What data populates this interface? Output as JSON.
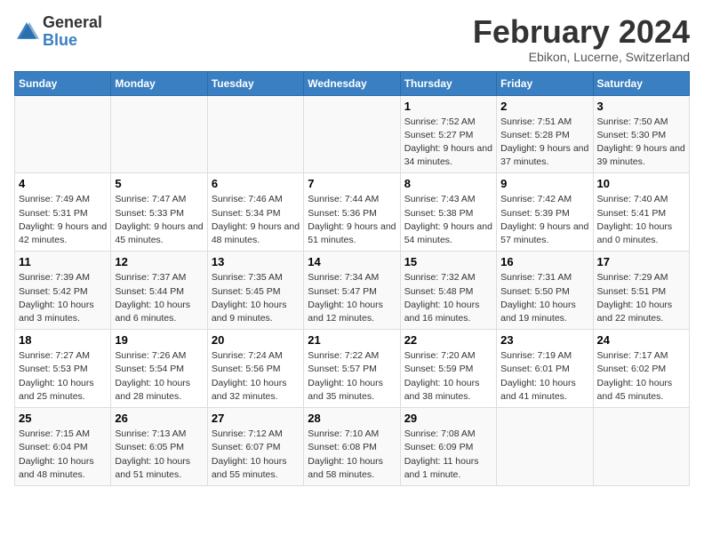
{
  "header": {
    "logo_general": "General",
    "logo_blue": "Blue",
    "title": "February 2024",
    "subtitle": "Ebikon, Lucerne, Switzerland"
  },
  "columns": [
    "Sunday",
    "Monday",
    "Tuesday",
    "Wednesday",
    "Thursday",
    "Friday",
    "Saturday"
  ],
  "weeks": [
    [
      {
        "day": "",
        "info": ""
      },
      {
        "day": "",
        "info": ""
      },
      {
        "day": "",
        "info": ""
      },
      {
        "day": "",
        "info": ""
      },
      {
        "day": "1",
        "info": "Sunrise: 7:52 AM\nSunset: 5:27 PM\nDaylight: 9 hours and 34 minutes."
      },
      {
        "day": "2",
        "info": "Sunrise: 7:51 AM\nSunset: 5:28 PM\nDaylight: 9 hours and 37 minutes."
      },
      {
        "day": "3",
        "info": "Sunrise: 7:50 AM\nSunset: 5:30 PM\nDaylight: 9 hours and 39 minutes."
      }
    ],
    [
      {
        "day": "4",
        "info": "Sunrise: 7:49 AM\nSunset: 5:31 PM\nDaylight: 9 hours and 42 minutes."
      },
      {
        "day": "5",
        "info": "Sunrise: 7:47 AM\nSunset: 5:33 PM\nDaylight: 9 hours and 45 minutes."
      },
      {
        "day": "6",
        "info": "Sunrise: 7:46 AM\nSunset: 5:34 PM\nDaylight: 9 hours and 48 minutes."
      },
      {
        "day": "7",
        "info": "Sunrise: 7:44 AM\nSunset: 5:36 PM\nDaylight: 9 hours and 51 minutes."
      },
      {
        "day": "8",
        "info": "Sunrise: 7:43 AM\nSunset: 5:38 PM\nDaylight: 9 hours and 54 minutes."
      },
      {
        "day": "9",
        "info": "Sunrise: 7:42 AM\nSunset: 5:39 PM\nDaylight: 9 hours and 57 minutes."
      },
      {
        "day": "10",
        "info": "Sunrise: 7:40 AM\nSunset: 5:41 PM\nDaylight: 10 hours and 0 minutes."
      }
    ],
    [
      {
        "day": "11",
        "info": "Sunrise: 7:39 AM\nSunset: 5:42 PM\nDaylight: 10 hours and 3 minutes."
      },
      {
        "day": "12",
        "info": "Sunrise: 7:37 AM\nSunset: 5:44 PM\nDaylight: 10 hours and 6 minutes."
      },
      {
        "day": "13",
        "info": "Sunrise: 7:35 AM\nSunset: 5:45 PM\nDaylight: 10 hours and 9 minutes."
      },
      {
        "day": "14",
        "info": "Sunrise: 7:34 AM\nSunset: 5:47 PM\nDaylight: 10 hours and 12 minutes."
      },
      {
        "day": "15",
        "info": "Sunrise: 7:32 AM\nSunset: 5:48 PM\nDaylight: 10 hours and 16 minutes."
      },
      {
        "day": "16",
        "info": "Sunrise: 7:31 AM\nSunset: 5:50 PM\nDaylight: 10 hours and 19 minutes."
      },
      {
        "day": "17",
        "info": "Sunrise: 7:29 AM\nSunset: 5:51 PM\nDaylight: 10 hours and 22 minutes."
      }
    ],
    [
      {
        "day": "18",
        "info": "Sunrise: 7:27 AM\nSunset: 5:53 PM\nDaylight: 10 hours and 25 minutes."
      },
      {
        "day": "19",
        "info": "Sunrise: 7:26 AM\nSunset: 5:54 PM\nDaylight: 10 hours and 28 minutes."
      },
      {
        "day": "20",
        "info": "Sunrise: 7:24 AM\nSunset: 5:56 PM\nDaylight: 10 hours and 32 minutes."
      },
      {
        "day": "21",
        "info": "Sunrise: 7:22 AM\nSunset: 5:57 PM\nDaylight: 10 hours and 35 minutes."
      },
      {
        "day": "22",
        "info": "Sunrise: 7:20 AM\nSunset: 5:59 PM\nDaylight: 10 hours and 38 minutes."
      },
      {
        "day": "23",
        "info": "Sunrise: 7:19 AM\nSunset: 6:01 PM\nDaylight: 10 hours and 41 minutes."
      },
      {
        "day": "24",
        "info": "Sunrise: 7:17 AM\nSunset: 6:02 PM\nDaylight: 10 hours and 45 minutes."
      }
    ],
    [
      {
        "day": "25",
        "info": "Sunrise: 7:15 AM\nSunset: 6:04 PM\nDaylight: 10 hours and 48 minutes."
      },
      {
        "day": "26",
        "info": "Sunrise: 7:13 AM\nSunset: 6:05 PM\nDaylight: 10 hours and 51 minutes."
      },
      {
        "day": "27",
        "info": "Sunrise: 7:12 AM\nSunset: 6:07 PM\nDaylight: 10 hours and 55 minutes."
      },
      {
        "day": "28",
        "info": "Sunrise: 7:10 AM\nSunset: 6:08 PM\nDaylight: 10 hours and 58 minutes."
      },
      {
        "day": "29",
        "info": "Sunrise: 7:08 AM\nSunset: 6:09 PM\nDaylight: 11 hours and 1 minute."
      },
      {
        "day": "",
        "info": ""
      },
      {
        "day": "",
        "info": ""
      }
    ]
  ]
}
